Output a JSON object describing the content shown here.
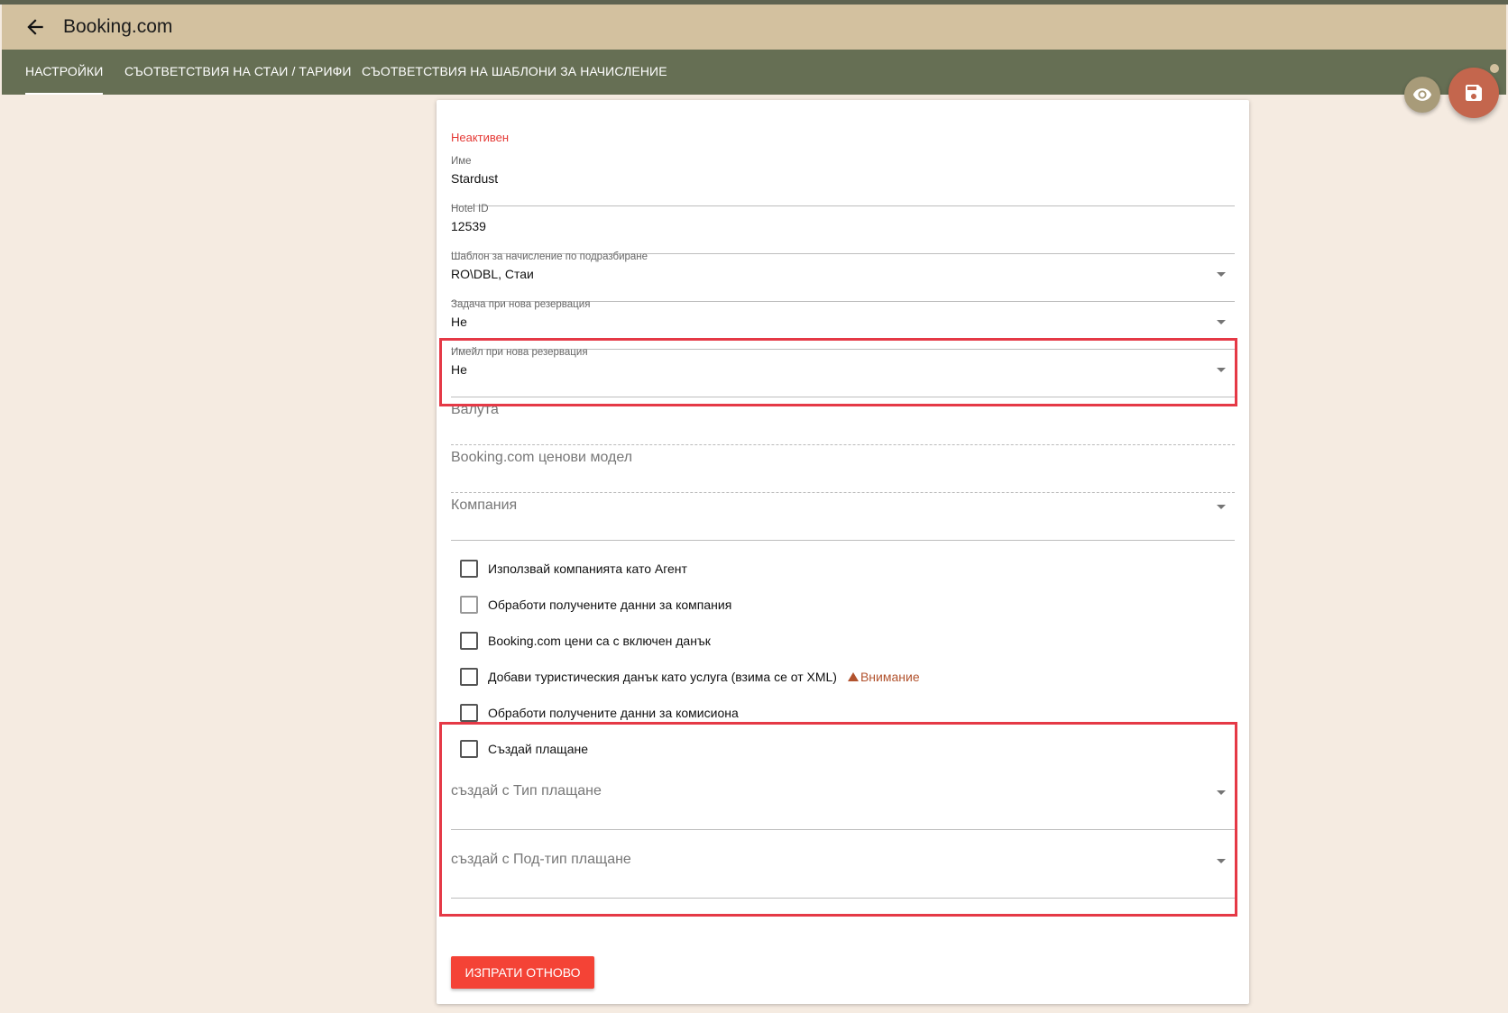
{
  "header": {
    "title": "Booking.com"
  },
  "tabs": [
    {
      "label": "НАСТРОЙКИ",
      "active": true
    },
    {
      "label": "СЪОТВЕТСТВИЯ НА СТАИ / ТАРИФИ",
      "active": false
    },
    {
      "label": "СЪОТВЕТСТВИЯ НА ШАБЛОНИ ЗА НАЧИСЛЕНИЕ",
      "active": false
    }
  ],
  "form": {
    "status": "Неактивен",
    "name": {
      "label": "Име",
      "value": "Stardust"
    },
    "hotel_id": {
      "label": "Hotel ID",
      "value": "12539"
    },
    "default_template": {
      "label": "Шаблон за начисление по подразбиране",
      "value": "RO\\DBL, Стаи"
    },
    "task_new_reservation": {
      "label": "Задача при нова резервация",
      "value": "Не"
    },
    "email_new_reservation": {
      "label": "Имейл при нова резервация",
      "value": "Не"
    },
    "currency": {
      "placeholder": "Валута"
    },
    "price_model": {
      "placeholder": "Booking.com ценови модел"
    },
    "company": {
      "placeholder": "Компания"
    },
    "checkboxes": {
      "use_company_as_agent": "Използвай компанията като Агент",
      "process_company_data": "Обработи получените данни за компания",
      "prices_include_tax": "Booking.com цени са с включен данък",
      "add_tourist_tax": "Добави туристическия данък като услуга (взима се от XML)",
      "process_commission": "Обработи получените данни за комисиона",
      "create_payment": "Създай плащане"
    },
    "warning": "Внимание",
    "payment_type": {
      "placeholder": "създай с Тип плащане"
    },
    "payment_subtype": {
      "placeholder": "създай с Под-тип плащане"
    },
    "resend_button": "ИЗПРАТИ ОТНОВО"
  },
  "colors": {
    "header_bg": "#d3c19f",
    "tabs_bg": "#666f54",
    "page_bg": "#f5ebe1",
    "accent_red": "#f44336",
    "save_fab": "#c4664d",
    "highlight_border": "#e53946"
  },
  "icons": {
    "back": "arrow-left-icon",
    "preview": "eye-icon",
    "save": "floppy-disk-icon"
  }
}
